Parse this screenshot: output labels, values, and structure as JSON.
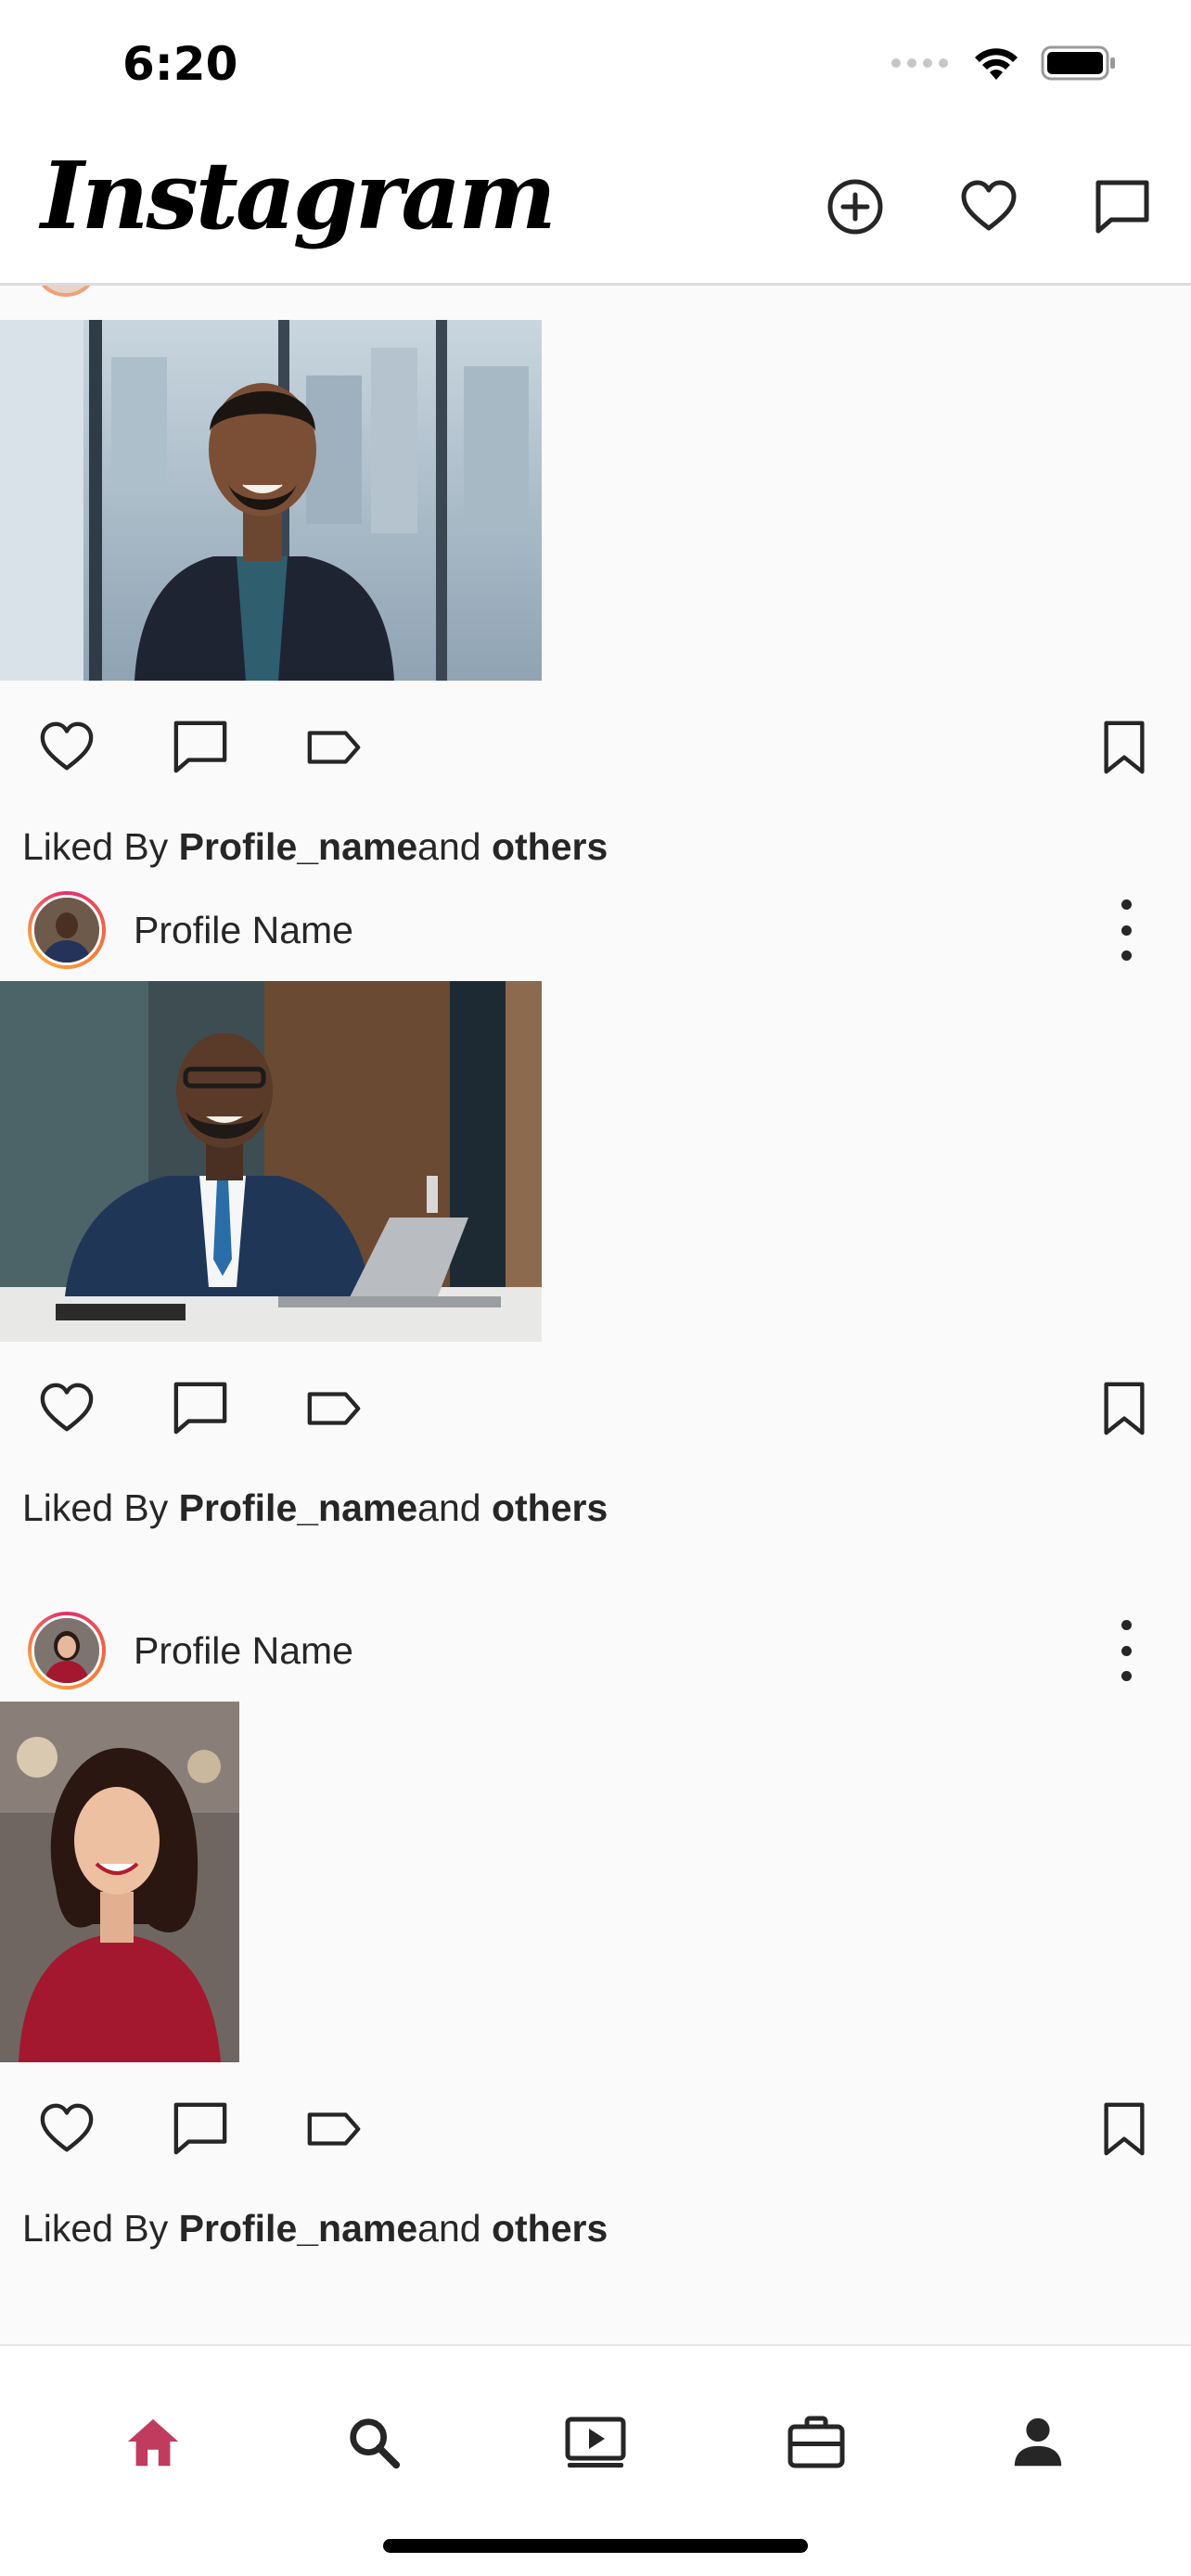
{
  "status_bar": {
    "time": "6:20"
  },
  "header": {
    "logo_text": "Instagram",
    "actions": [
      {
        "name": "new-post",
        "icon": "plus-circle-icon"
      },
      {
        "name": "activity",
        "icon": "heart-icon"
      },
      {
        "name": "messages",
        "icon": "chat-bubble-icon"
      }
    ]
  },
  "feed": {
    "posts": [
      {
        "profile_name": "",
        "image": "man-in-blazer-office",
        "liked_by": {
          "prefix": "Liked By ",
          "user": "Profile_name",
          "and": "and ",
          "others": "others"
        }
      },
      {
        "profile_name": "Profile Name",
        "image": "businessman-at-desk",
        "liked_by": {
          "prefix": "Liked By ",
          "user": "Profile_name",
          "and": "and ",
          "others": "others"
        }
      },
      {
        "profile_name": "Profile Name",
        "image": "woman-red-top",
        "liked_by": {
          "prefix": "Liked By ",
          "user": "Profile_name",
          "and": "and ",
          "others": "others"
        }
      }
    ]
  },
  "bottom_nav": {
    "items": [
      {
        "name": "home",
        "icon": "home-icon",
        "active": true
      },
      {
        "name": "search",
        "icon": "search-icon",
        "active": false
      },
      {
        "name": "reels",
        "icon": "video-play-icon",
        "active": false
      },
      {
        "name": "shop",
        "icon": "briefcase-icon",
        "active": false
      },
      {
        "name": "profile",
        "icon": "person-icon",
        "active": false
      }
    ]
  },
  "colors": {
    "accent": "#c13b5f",
    "text": "#262626",
    "background": "#fafafa"
  }
}
